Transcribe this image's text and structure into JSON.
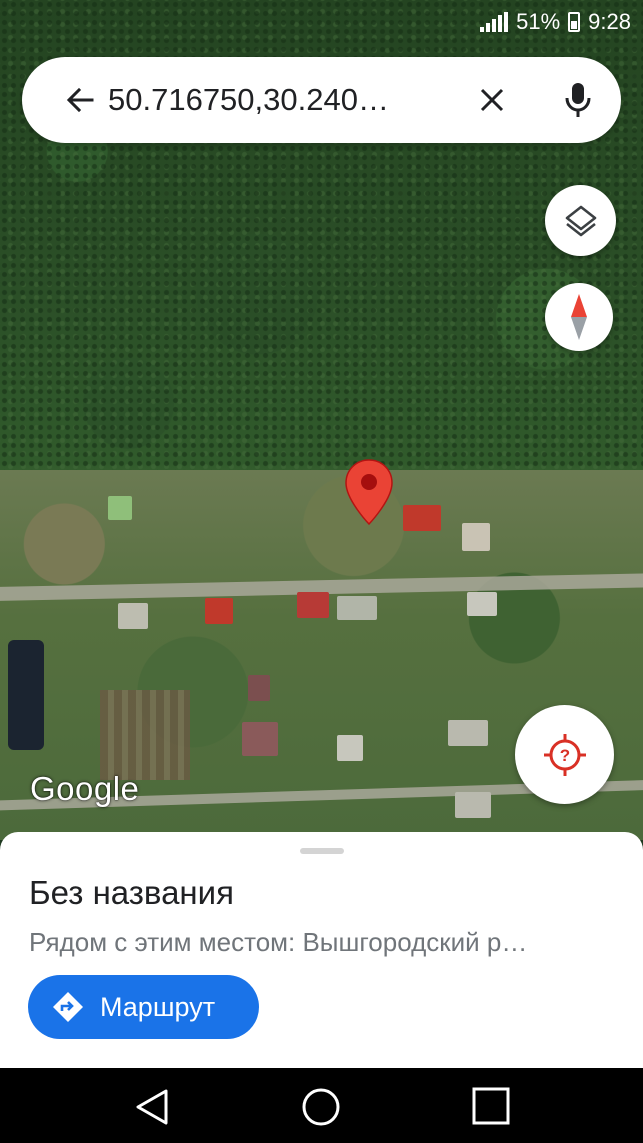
{
  "status_bar": {
    "battery": "51%",
    "time": "9:28"
  },
  "search": {
    "query": "50.716750,30.240…"
  },
  "map": {
    "attribution": "Google",
    "marker_color": "#ea4335"
  },
  "place": {
    "title": "Без названия",
    "subtitle": "Рядом с этим местом: Вышгородский р…",
    "route_label": "Маршрут"
  },
  "colors": {
    "accent": "#1a73e8",
    "location_accent": "#d93025"
  },
  "icons": [
    "back-arrow-icon",
    "clear-icon",
    "microphone-icon",
    "layers-icon",
    "compass-icon",
    "location-unknown-icon",
    "directions-icon",
    "nav-back-icon",
    "nav-home-icon",
    "nav-recents-icon"
  ]
}
